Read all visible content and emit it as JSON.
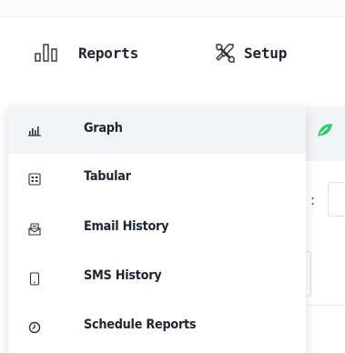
{
  "nav": {
    "reports": {
      "label": "Reports",
      "icon": "bar-chart-icon"
    },
    "setup": {
      "label": "Setup",
      "icon": "tools-icon"
    }
  },
  "background": {
    "colon_text": ":"
  },
  "reports_menu": {
    "items": [
      {
        "label": "Graph",
        "icon": "graph-icon",
        "active": true
      },
      {
        "label": "Tabular",
        "icon": "table-icon",
        "active": false
      },
      {
        "label": "Email History",
        "icon": "email-icon",
        "active": false
      },
      {
        "label": "SMS History",
        "icon": "sms-icon",
        "active": false
      },
      {
        "label": "Schedule Reports",
        "icon": "clock-icon",
        "active": false
      }
    ]
  },
  "colors": {
    "text": "#1f2530",
    "hover_bg": "#f3f4f6",
    "accent_green": "#2ecc71"
  }
}
